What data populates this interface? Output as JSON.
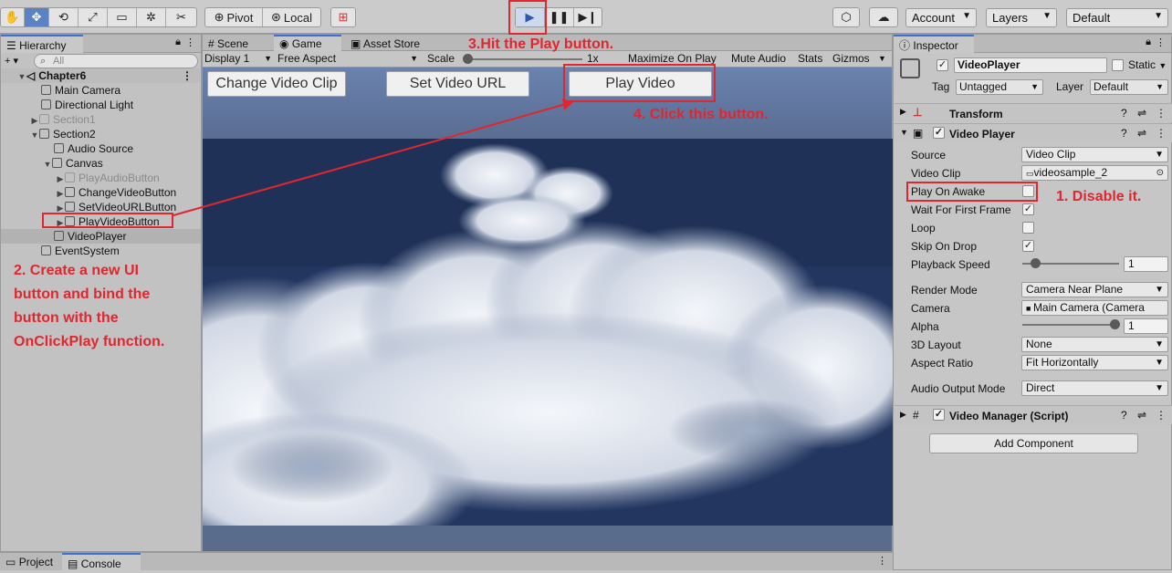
{
  "toolbar": {
    "pivot_label": "Pivot",
    "local_label": "Local",
    "account_label": "Account",
    "layers_label": "Layers",
    "layout_label": "Default"
  },
  "hierarchy": {
    "tab_label": "Hierarchy",
    "search_placeholder": "All",
    "scene_name": "Chapter6",
    "items": [
      {
        "label": "Main Camera"
      },
      {
        "label": "Directional Light"
      },
      {
        "label": "Section1"
      },
      {
        "label": "Section2"
      },
      {
        "label": "Audio Source"
      },
      {
        "label": "Canvas"
      },
      {
        "label": "PlayAudioButton"
      },
      {
        "label": "ChangeVideoButton"
      },
      {
        "label": "SetVideoURLButton"
      },
      {
        "label": "PlayVideoButton"
      },
      {
        "label": "VideoPlayer"
      },
      {
        "label": "EventSystem"
      }
    ]
  },
  "center_tabs": {
    "scene": "Scene",
    "game": "Game",
    "asset_store": "Asset Store"
  },
  "game_toolbar": {
    "display": "Display 1",
    "aspect": "Free Aspect",
    "scale_label": "Scale",
    "scale_value": "1x",
    "maximize": "Maximize On Play",
    "mute": "Mute Audio",
    "stats": "Stats",
    "gizmos": "Gizmos"
  },
  "game_view": {
    "change_clip_btn": "Change Video Clip",
    "set_url_btn": "Set Video URL",
    "play_video_btn": "Play Video"
  },
  "bottom_tabs": {
    "project": "Project",
    "console": "Console"
  },
  "inspector": {
    "tab_label": "Inspector",
    "object_name": "VideoPlayer",
    "static_label": "Static",
    "tag_label": "Tag",
    "tag_value": "Untagged",
    "layer_label": "Layer",
    "layer_value": "Default",
    "transform_label": "Transform",
    "video_player_label": "Video Player",
    "fields": {
      "source_label": "Source",
      "source_value": "Video Clip",
      "video_clip_label": "Video Clip",
      "video_clip_value": "videosample_2",
      "play_on_awake_label": "Play On Awake",
      "wait_first_frame_label": "Wait For First Frame",
      "loop_label": "Loop",
      "skip_on_drop_label": "Skip On Drop",
      "playback_speed_label": "Playback Speed",
      "playback_speed_value": "1",
      "render_mode_label": "Render Mode",
      "render_mode_value": "Camera Near Plane",
      "camera_label": "Camera",
      "camera_value": "Main Camera (Camera",
      "alpha_label": "Alpha",
      "alpha_value": "1",
      "layout_3d_label": "3D Layout",
      "layout_3d_value": "None",
      "aspect_ratio_label": "Aspect Ratio",
      "aspect_ratio_value": "Fit Horizontally",
      "audio_output_label": "Audio Output Mode",
      "audio_output_value": "Direct"
    },
    "script_label": "Video Manager (Script)",
    "add_component": "Add Component"
  },
  "annotations": {
    "step1": "1. Disable it.",
    "step2_lines": [
      "2. Create a new UI",
      "button and bind the",
      "button with the",
      "OnClickPlay function."
    ],
    "step3": "3.Hit the Play button.",
    "step4": "4. Click this button."
  },
  "colors": {
    "accent_blue": "#3a72d8",
    "play_active": "#5b82c4",
    "annotation_red": "#e0262f",
    "sky_dark": "#1f3157",
    "sky_top": "#5e79a6"
  }
}
